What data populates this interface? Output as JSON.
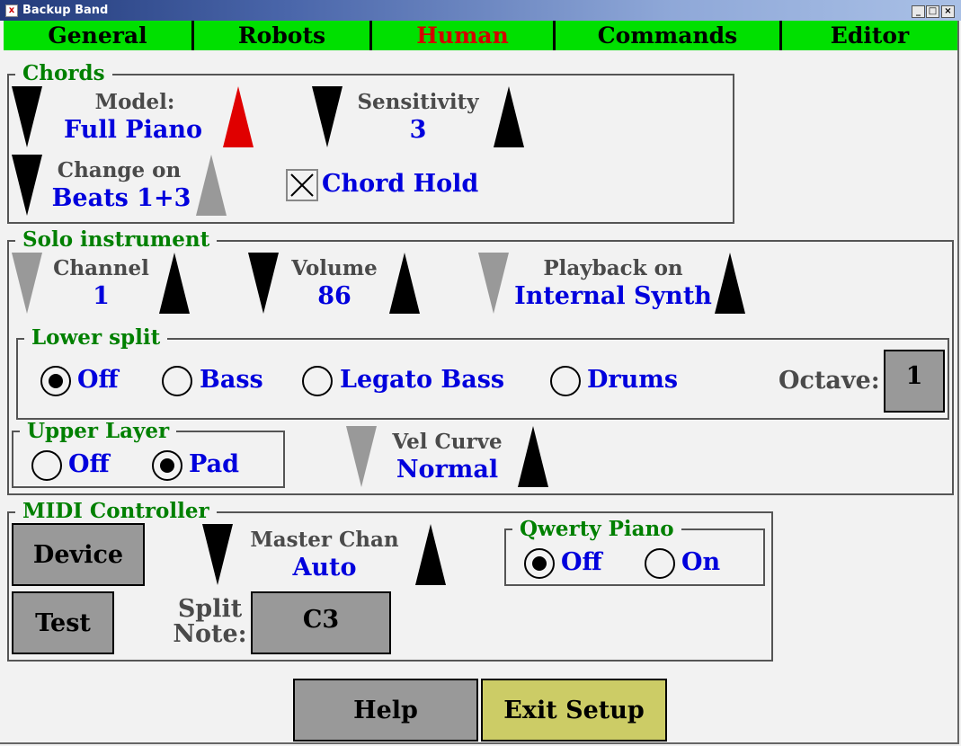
{
  "window": {
    "title": "Backup Band",
    "app_icon": "x-app-icon",
    "controls": {
      "minimize": "_",
      "maximize": "□",
      "close": "×"
    }
  },
  "tabs": [
    {
      "label": "General",
      "active": false
    },
    {
      "label": "Robots",
      "active": false
    },
    {
      "label": "Human",
      "active": true
    },
    {
      "label": "Commands",
      "active": false
    },
    {
      "label": "Editor",
      "active": false
    }
  ],
  "chords": {
    "legend": "Chords",
    "model": {
      "label": "Model:",
      "value": "Full Piano"
    },
    "sensitivity": {
      "label": "Sensitivity",
      "value": "3"
    },
    "change_on": {
      "label": "Change on",
      "value": "Beats 1+3"
    },
    "chord_hold": {
      "label": "Chord Hold",
      "checked": true
    }
  },
  "solo": {
    "legend": "Solo instrument",
    "channel": {
      "label": "Channel",
      "value": "1"
    },
    "volume": {
      "label": "Volume",
      "value": "86"
    },
    "playback": {
      "label": "Playback on",
      "value": "Internal Synth"
    },
    "lower_split": {
      "legend": "Lower split",
      "options": [
        "Off",
        "Bass",
        "Legato Bass",
        "Drums"
      ],
      "selected": "Off",
      "octave_label": "Octave:",
      "octave_value": "1"
    },
    "upper_layer": {
      "legend": "Upper Layer",
      "options": [
        "Off",
        "Pad"
      ],
      "selected": "Pad"
    },
    "vel_curve": {
      "label": "Vel Curve",
      "value": "Normal"
    }
  },
  "midi": {
    "legend": "MIDI Controller",
    "device_button": "Device",
    "test_button": "Test",
    "master_chan": {
      "label": "Master Chan",
      "value": "Auto"
    },
    "split_note": {
      "label_line1": "Split",
      "label_line2": "Note:",
      "value": "C3"
    },
    "qwerty": {
      "legend": "Qwerty Piano",
      "options": [
        "Off",
        "On"
      ],
      "selected": "Off"
    }
  },
  "footer": {
    "help_button": "Help",
    "exit_button": "Exit Setup"
  },
  "colors": {
    "tab_bar": "#00e000",
    "active_tab": "#d40000",
    "legend": "#008000",
    "value": "#0000dd",
    "label": "#4a4a4a",
    "button": "#999999",
    "exit_button": "#cccc66",
    "arrow_disabled": "#999999",
    "arrow_highlight": "#e00000"
  }
}
